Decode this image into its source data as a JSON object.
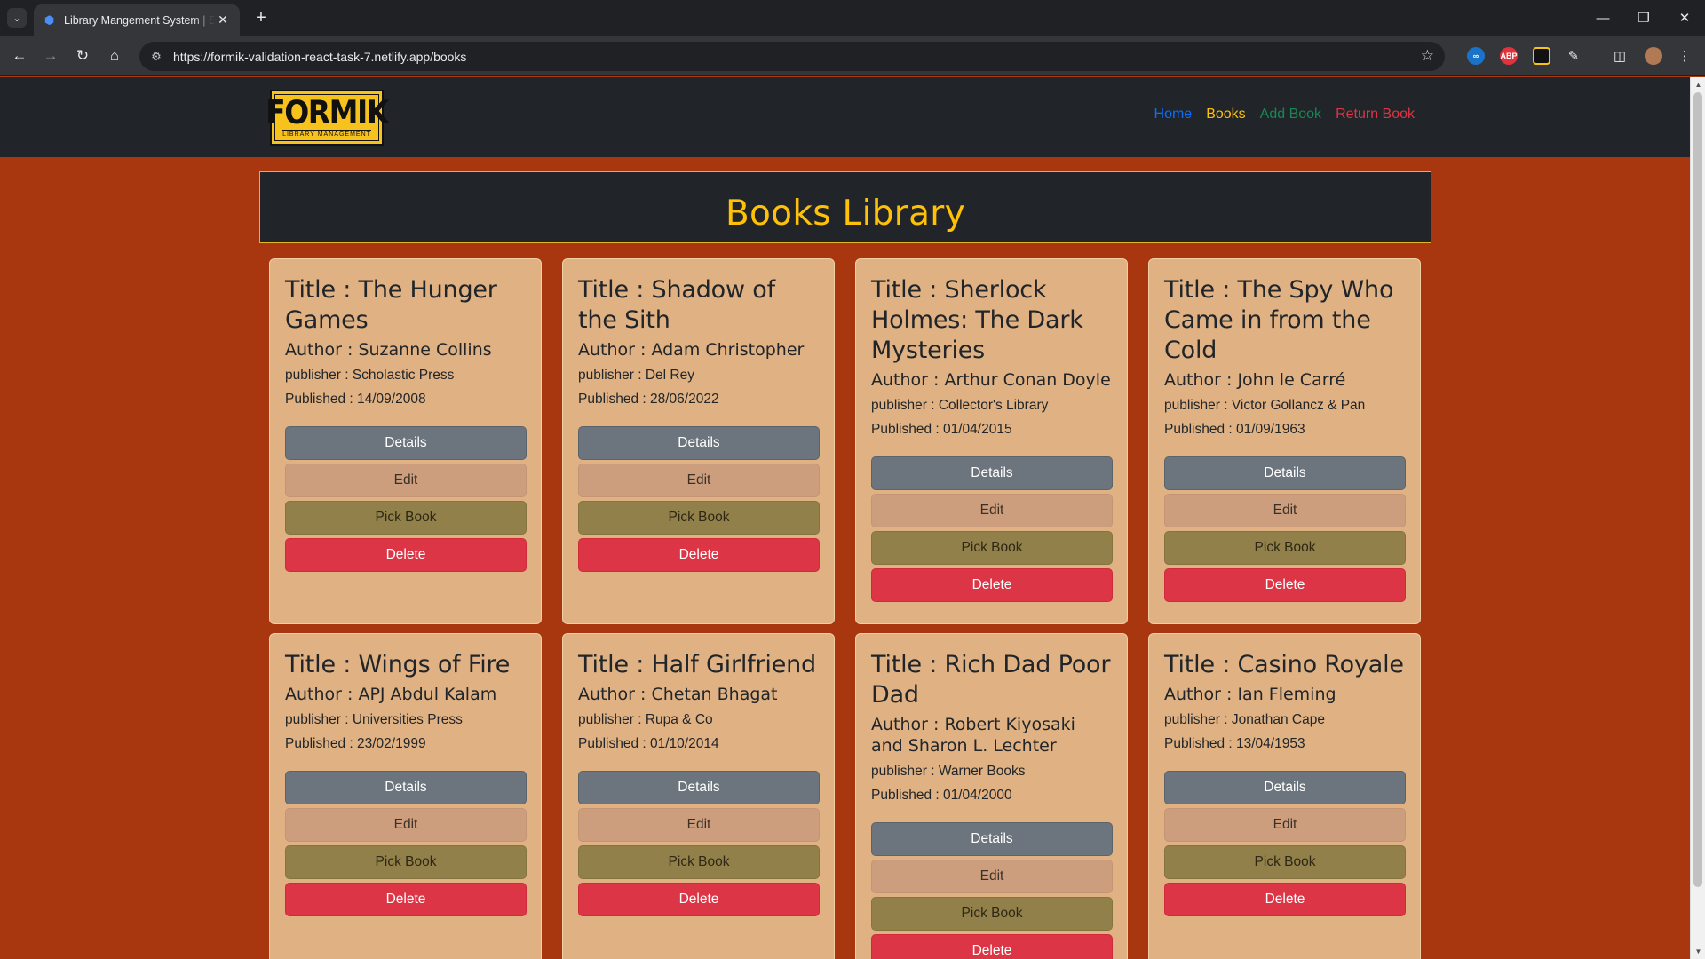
{
  "browser": {
    "tab_title": "Library Mangement System | Sw",
    "url": "https://formik-validation-react-task-7.netlify.app/books",
    "extensions": {
      "abp_label": "ABP"
    }
  },
  "app": {
    "logo_text": "FORMIK",
    "logo_subtext": "LIBRARY MANAGEMENT",
    "nav": [
      {
        "label": "Home",
        "color": "#0d6efd"
      },
      {
        "label": "Books",
        "color": "#ffc107"
      },
      {
        "label": "Add Book",
        "color": "#198754"
      },
      {
        "label": "Return Book",
        "color": "#dc3545"
      }
    ],
    "heading": "Books Library"
  },
  "labels": {
    "details": "Details",
    "edit": "Edit",
    "pick": "Pick Book",
    "delete": "Delete"
  },
  "books": [
    {
      "title": "Title : The Hunger Games",
      "author": "Author : Suzanne Collins",
      "publisher": "publisher : Scholastic Press",
      "published": "Published : 14/09/2008"
    },
    {
      "title": "Title : Shadow of the Sith",
      "author": "Author : Adam Christopher",
      "publisher": "publisher : Del Rey",
      "published": "Published : 28/06/2022"
    },
    {
      "title": "Title : Sherlock Holmes: The Dark Mysteries",
      "author": "Author : Arthur Conan Doyle",
      "publisher": "publisher : Collector's Library",
      "published": "Published : 01/04/2015"
    },
    {
      "title": "Title : The Spy Who Came in from the Cold",
      "author": "Author : John le Carré",
      "publisher": "publisher : Victor Gollancz & Pan",
      "published": "Published : 01/09/1963"
    },
    {
      "title": "Title : Wings of Fire",
      "author": "Author : APJ Abdul Kalam",
      "publisher": "publisher : Universities Press",
      "published": "Published : 23/02/1999"
    },
    {
      "title": "Title : Half Girlfriend",
      "author": "Author : Chetan Bhagat",
      "publisher": "publisher : Rupa & Co",
      "published": "Published : 01/10/2014"
    },
    {
      "title": "Title : Rich Dad Poor Dad",
      "author": "Author : Robert Kiyosaki and Sharon L. Lechter",
      "publisher": "publisher : Warner Books",
      "published": "Published : 01/04/2000"
    },
    {
      "title": "Title : Casino Royale",
      "author": "Author : Ian Fleming",
      "publisher": "publisher : Jonathan Cape",
      "published": "Published : 13/04/1953"
    }
  ]
}
